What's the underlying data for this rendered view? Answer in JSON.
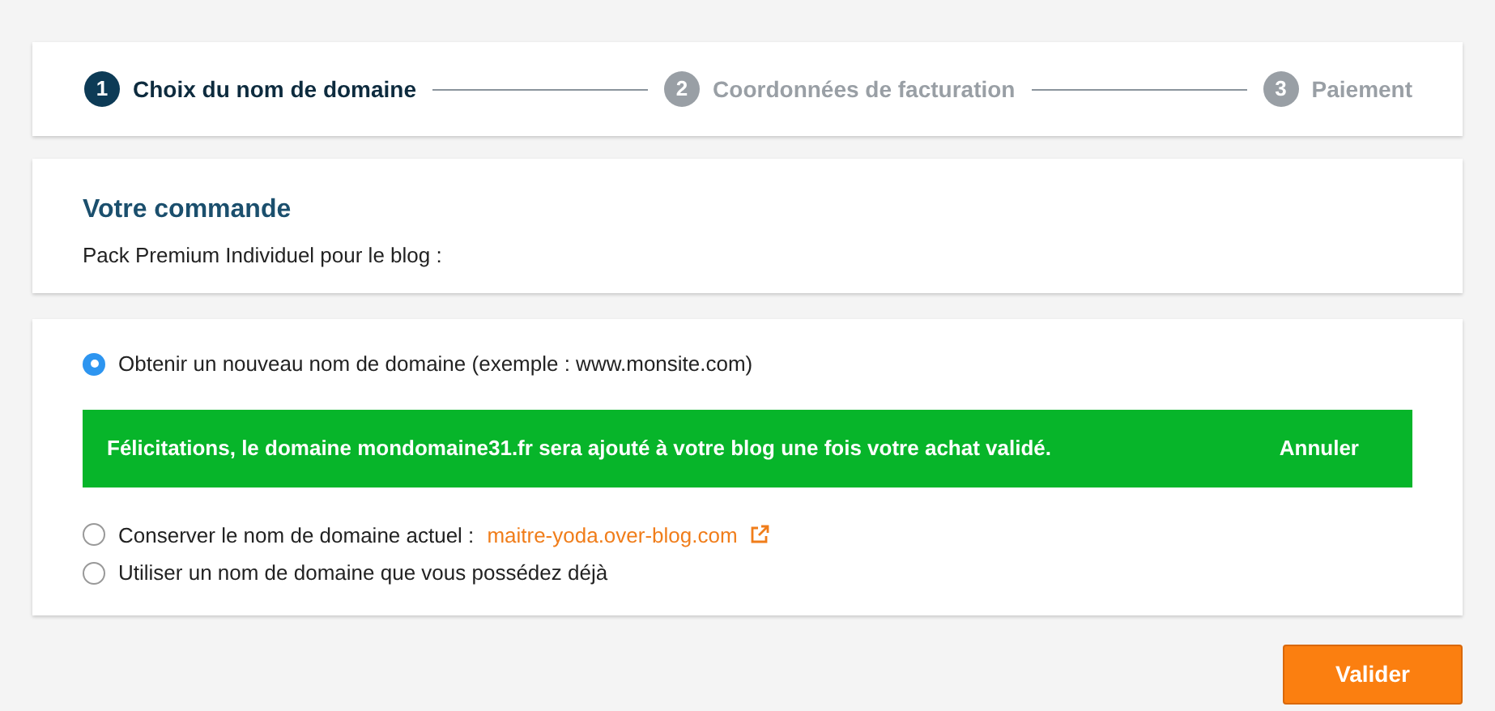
{
  "steps": [
    {
      "number": "1",
      "label": "Choix du nom de domaine",
      "active": true
    },
    {
      "number": "2",
      "label": "Coordonnées de facturation",
      "active": false
    },
    {
      "number": "3",
      "label": "Paiement",
      "active": false
    }
  ],
  "order": {
    "title": "Votre commande",
    "text": "Pack Premium Individuel pour le blog :"
  },
  "options": [
    {
      "label": "Obtenir un nouveau nom de domaine (exemple : www.monsite.com)",
      "selected": true
    },
    {
      "label": "Conserver le nom de domaine actuel :",
      "link": "maitre-yoda.over-blog.com",
      "selected": false
    },
    {
      "label": "Utiliser un nom de domaine que vous possédez déjà",
      "selected": false
    }
  ],
  "notice": {
    "text": "Félicitations, le domaine **mondomaine31.fr** sera ajouté à votre blog une fois votre achat validé.",
    "action": "Annuler"
  },
  "submit": "Valider"
}
